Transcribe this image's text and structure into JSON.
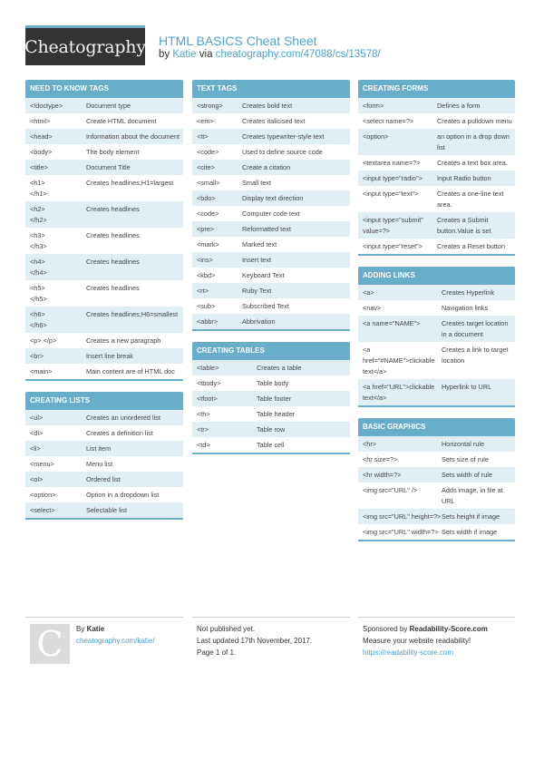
{
  "header": {
    "logo_text": "Cheatography",
    "title": "HTML BASICS Cheat Sheet",
    "by_label": "by",
    "author": "Katie",
    "via_label": "via",
    "url": "cheatography.com/47088/cs/13578/"
  },
  "sections": {
    "need_to_know": {
      "title": "NEED TO KNOW TAGS",
      "rows": [
        {
          "k": "<!doctype>",
          "v": "Document type"
        },
        {
          "k": "<html>",
          "v": "Create HTML document"
        },
        {
          "k": "<head>",
          "v": "Information about the document"
        },
        {
          "k": "<body>",
          "v": "The body element"
        },
        {
          "k": "<title>",
          "v": "Document Title"
        },
        {
          "k": "<h1>\n</h1>",
          "v": "Creates headlines;H1=largest"
        },
        {
          "k": "<h2>\n</h2>",
          "v": "Creates headlines"
        },
        {
          "k": "<h3>\n</h3>",
          "v": "Creates headlines"
        },
        {
          "k": "<h4>\n</h4>",
          "v": "Creates headlines"
        },
        {
          "k": "<h5>\n</h5>",
          "v": "Creates headlines"
        },
        {
          "k": "<h6>\n</h6>",
          "v": "Creates headlines;H6=smallest"
        },
        {
          "k": "<p> </p>",
          "v": "Creates a new paragraph"
        },
        {
          "k": "<br>",
          "v": "Insert line break"
        },
        {
          "k": "<main>",
          "v": "Main content are of HTML doc"
        }
      ]
    },
    "creating_lists": {
      "title": "CREATING LISTS",
      "rows": [
        {
          "k": "<ul>",
          "v": "Creates an unordered list"
        },
        {
          "k": "<dl>",
          "v": "Creates a definition list"
        },
        {
          "k": "<li>",
          "v": "List item"
        },
        {
          "k": "<menu>",
          "v": "Menu list"
        },
        {
          "k": "<ol>",
          "v": "Ordered list"
        },
        {
          "k": "<option>",
          "v": "Option in a dropdown list"
        },
        {
          "k": "<select>",
          "v": "Selectable list"
        }
      ]
    },
    "text_tags": {
      "title": "TEXT TAGS",
      "rows": [
        {
          "k": "<strong>",
          "v": "Creates bold text"
        },
        {
          "k": "<em>",
          "v": "Creates italicised text"
        },
        {
          "k": "<tt>",
          "v": "Creates typewriter-style text"
        },
        {
          "k": "<code>",
          "v": "Used to define source code"
        },
        {
          "k": "<cite>",
          "v": "Create a citation"
        },
        {
          "k": "<small>",
          "v": "Small text"
        },
        {
          "k": "<bdo>",
          "v": "Display text direction"
        },
        {
          "k": "<code>",
          "v": "Computer code text"
        },
        {
          "k": "<pre>",
          "v": "Reformatted text"
        },
        {
          "k": "<mark>",
          "v": "Marked text"
        },
        {
          "k": "<ins>",
          "v": "Insert text"
        },
        {
          "k": "<kbd>",
          "v": "Keyboard Text"
        },
        {
          "k": "<rt>",
          "v": "Ruby Text"
        },
        {
          "k": "<sub>",
          "v": "Subscribed Text"
        },
        {
          "k": "<abbr>",
          "v": "Abbrivation"
        }
      ]
    },
    "creating_tables": {
      "title": "CREATING TABLES",
      "rows": [
        {
          "k": "<table>",
          "v": "Creates a table"
        },
        {
          "k": "<tbody>",
          "v": "Table body"
        },
        {
          "k": "<tfoot>",
          "v": "Table footer"
        },
        {
          "k": "<th>",
          "v": "Table header"
        },
        {
          "k": "<tr>",
          "v": "Table row"
        },
        {
          "k": "<td>",
          "v": "Table cell"
        }
      ]
    },
    "creating_forms": {
      "title": "CREATING FORMS",
      "rows": [
        {
          "k": "<form>",
          "v": "Defines a form"
        },
        {
          "k": "<select name=?>",
          "v": "Creates a pulldown menu"
        },
        {
          "k": "<option>",
          "v": "an option in a drop down list"
        },
        {
          "k": "<textarea name=?>",
          "v": "Creates a text box area."
        },
        {
          "k": "<input type=\"radio\">",
          "v": "Input Radio button"
        },
        {
          "k": "<input type=\"text\">",
          "v": "Creates a one-line text area."
        },
        {
          "k": "<input type=\"submit\" value=?>",
          "v": "Creates a Submit button.Value is set"
        },
        {
          "k": "<input type=\"reset\">",
          "v": "Creates a Reset button"
        }
      ]
    },
    "adding_links": {
      "title": "ADDING LINKS",
      "rows": [
        {
          "k": "<a>",
          "v": "Creates Hyperlink"
        },
        {
          "k": "<nav>",
          "v": "Navigation links"
        },
        {
          "k": "<a name=\"NAME\">",
          "v": "Creates target location in a document"
        },
        {
          "k": "<a href=\"#NAME\">clickable text</a>",
          "v": "Creates a link to target location"
        },
        {
          "k": "<a href=\"URL\">clickable text</a>",
          "v": "Hyperlink to URL"
        }
      ]
    },
    "basic_graphics": {
      "title": "BASIC GRAPHICS",
      "rows": [
        {
          "k": "<hr>",
          "v": "Horizontal rule"
        },
        {
          "k": "<hr size=?>",
          "v": "Sets size of rule"
        },
        {
          "k": "<hr width=?>",
          "v": "Sets width of rule"
        },
        {
          "k": "<img src=\"URL\" />",
          "v": "Adds image, in file at URL"
        },
        {
          "k": "<img src=\"URL\" height=?>",
          "v": "Sets height if image"
        },
        {
          "k": "<img src=\"URL\" width=?>",
          "v": "Sets width if image"
        }
      ]
    }
  },
  "footer": {
    "avatar_letter": "C",
    "by_label": "By",
    "author": "Katie",
    "author_url": "cheatography.com/katie/",
    "published": "Not published yet.",
    "updated": "Last updated 17th November, 2017.",
    "page": "Page 1 of 1.",
    "sponsor_label": "Sponsored by",
    "sponsor_name": "Readability-Score.com",
    "sponsor_tagline": "Measure your website readability!",
    "sponsor_url": "https://readability-score.com"
  }
}
